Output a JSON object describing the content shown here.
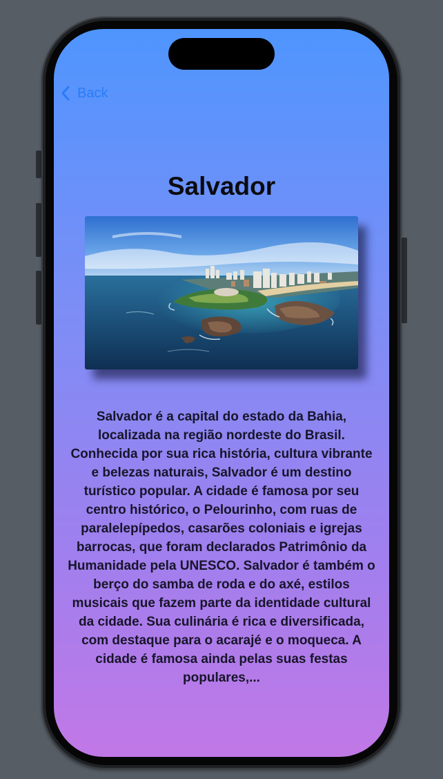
{
  "nav": {
    "back_label": "Back"
  },
  "page": {
    "title": "Salvador",
    "description": "Salvador é a capital do estado da Bahia, localizada na região nordeste do Brasil. Conhecida por sua rica história, cultura vibrante e belezas naturais, Salvador é um destino turístico popular. A cidade é famosa por seu centro histórico, o Pelourinho, com ruas de paralelepípedos, casarões coloniais e igrejas barrocas, que foram declarados Patrimônio da Humanidade pela UNESCO. Salvador é também o berço do samba de roda e do axé, estilos musicais que fazem parte da identidade cultural da cidade. Sua culinária é rica e diversificada, com destaque para o acarajé e o moqueca. A cidade é famosa ainda pelas suas festas populares,..."
  },
  "image": {
    "subject": "aerial-coastline-photo"
  },
  "icons": {
    "back": "chevron-left-icon"
  },
  "colors": {
    "accent": "#2a7cf7",
    "gradient_top": "#4f95fe",
    "gradient_bottom": "#c178e6",
    "text": "#17152a"
  }
}
